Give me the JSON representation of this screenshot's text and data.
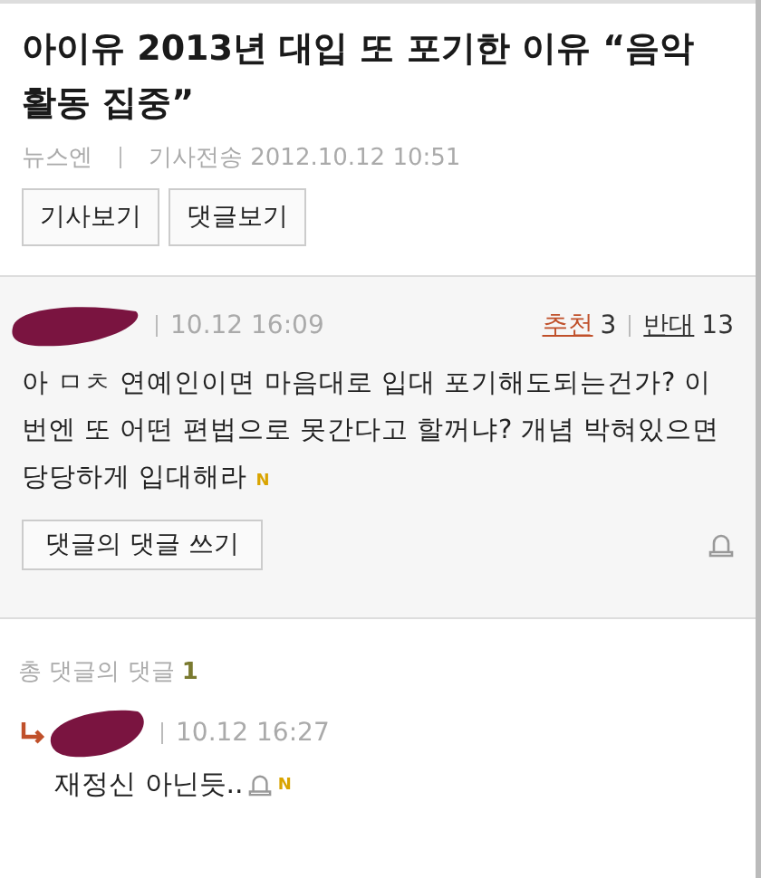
{
  "article": {
    "title": "아이유 2013년 대입 또 포기한 이유 “음악 활동 집중”",
    "source": "뉴스엔",
    "sent": "기사전송 2012.10.12 10:51",
    "buttons": [
      "기사보기",
      "댓글보기"
    ]
  },
  "comment": {
    "time": "10.12 16:09",
    "like_label": "추천",
    "likes": "3",
    "dislike_label": "반대",
    "dislikes": "13",
    "text": "아 ㅁㅊ 연예인이면 마음대로 입대 포기해도되는건가? 이번엔 또 어떤 편법으로 못간다고 할꺼냐? 개념 박혀있으면 당당하게 입대해라",
    "new_badge": "N",
    "reply_button": "댓글의 댓글 쓰기"
  },
  "replies": {
    "label": "총 댓글의 댓글",
    "count": "1",
    "items": [
      {
        "time": "10.12 16:27",
        "text": "재정신 아닌듯..",
        "new_badge": "N"
      }
    ]
  }
}
